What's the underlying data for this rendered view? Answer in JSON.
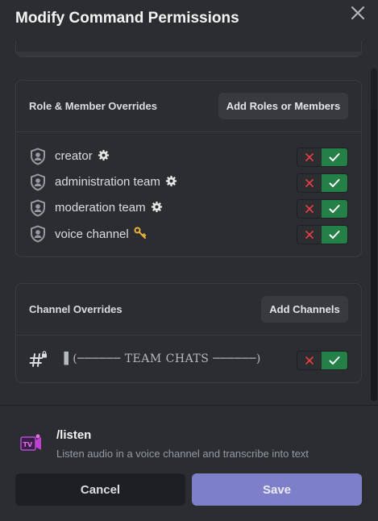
{
  "modal": {
    "title": "Modify Command Permissions",
    "close_icon": "close-icon"
  },
  "role_overrides": {
    "title": "Role & Member Overrides",
    "add_button": "Add Roles or Members",
    "rows": [
      {
        "label": "creator",
        "icon": "role-shield-icon",
        "emoji": "gear-icon",
        "state": "allow"
      },
      {
        "label": "administration team",
        "icon": "role-shield-icon",
        "emoji": "gear-icon",
        "state": "allow"
      },
      {
        "label": "moderation team",
        "icon": "role-shield-icon",
        "emoji": "gear-icon",
        "state": "allow"
      },
      {
        "label": "voice channel",
        "icon": "role-shield-icon",
        "emoji": "key-icon",
        "state": "allow"
      }
    ]
  },
  "channel_overrides": {
    "title": "Channel Overrides",
    "add_button": "Add Channels",
    "rows": [
      {
        "label": "▐ (────── TEAM CHATS ──────)",
        "icon": "hash-lock-icon",
        "state": "allow"
      }
    ]
  },
  "command": {
    "name": "/listen",
    "description": "Listen audio in a voice channel and transcribe into text",
    "icon": "tv-camera-icon"
  },
  "footer": {
    "cancel_label": "Cancel",
    "save_label": "Save"
  },
  "colors": {
    "background": "#2b2d31",
    "allow_green": "#248046",
    "deny_red": "#f23f42",
    "save_button": "#7e7fc9",
    "cancel_button": "#1e1f22"
  }
}
